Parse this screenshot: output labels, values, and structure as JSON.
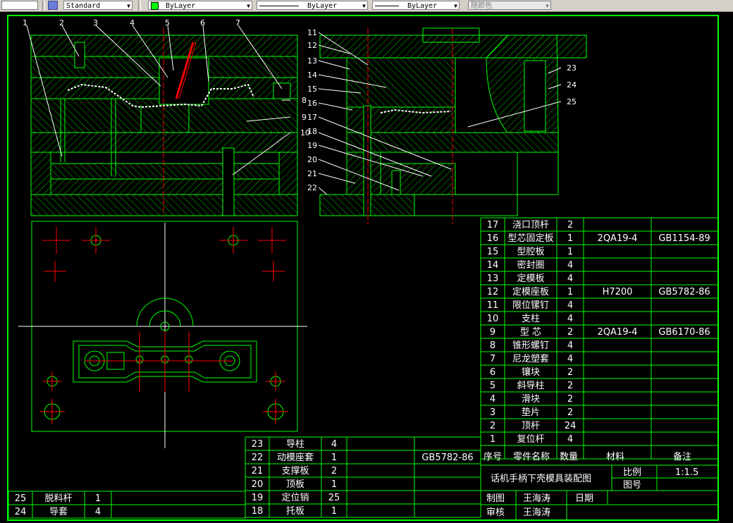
{
  "toolbar": {
    "textstyle": "Standard",
    "layer": "ByLayer",
    "linetype": "ByLayer",
    "lineweight": "ByLayer",
    "plotstyle": "随颜色"
  },
  "callouts": [
    "1",
    "2",
    "3",
    "4",
    "5",
    "6",
    "7",
    "8",
    "9",
    "10",
    "11",
    "12",
    "13",
    "14",
    "15",
    "16",
    "17",
    "18",
    "19",
    "20",
    "21",
    "22",
    "23",
    "24",
    "25"
  ],
  "parts": [
    {
      "no": "17",
      "name": "浇口顶杆",
      "qty": "2",
      "mat": "",
      "note": ""
    },
    {
      "no": "16",
      "name": "型芯固定板",
      "qty": "1",
      "mat": "2QA19-4",
      "note": "GB1154-89"
    },
    {
      "no": "15",
      "name": "型腔板",
      "qty": "1",
      "mat": "",
      "note": ""
    },
    {
      "no": "14",
      "name": "密封圈",
      "qty": "4",
      "mat": "",
      "note": ""
    },
    {
      "no": "13",
      "name": "定模板",
      "qty": "4",
      "mat": "",
      "note": ""
    },
    {
      "no": "12",
      "name": "定模座板",
      "qty": "1",
      "mat": "H7200",
      "note": "GB5782-86"
    },
    {
      "no": "11",
      "name": "限位镙钉",
      "qty": "4",
      "mat": "",
      "note": ""
    },
    {
      "no": "10",
      "name": "支柱",
      "qty": "4",
      "mat": "",
      "note": ""
    },
    {
      "no": "9",
      "name": "型  芯",
      "qty": "2",
      "mat": "2QA19-4",
      "note": "GB6170-86"
    },
    {
      "no": "8",
      "name": "锥形螺钉",
      "qty": "4",
      "mat": "",
      "note": ""
    },
    {
      "no": "7",
      "name": "尼龙塑套",
      "qty": "4",
      "mat": "",
      "note": ""
    },
    {
      "no": "6",
      "name": "镶块",
      "qty": "2",
      "mat": "",
      "note": ""
    },
    {
      "no": "5",
      "name": "斜导柱",
      "qty": "2",
      "mat": "",
      "note": ""
    },
    {
      "no": "4",
      "name": "滑块",
      "qty": "2",
      "mat": "",
      "note": ""
    },
    {
      "no": "3",
      "name": "垫片",
      "qty": "2",
      "mat": "",
      "note": ""
    },
    {
      "no": "2",
      "name": "顶杆",
      "qty": "24",
      "mat": "",
      "note": ""
    },
    {
      "no": "1",
      "name": "复位杆",
      "qty": "4",
      "mat": "",
      "note": ""
    }
  ],
  "parts_header": {
    "no": "序号",
    "name": "零件名称",
    "qty": "数量",
    "mat": "材料",
    "note": "备注"
  },
  "parts2": [
    {
      "no": "23",
      "name": "导柱",
      "qty": "4",
      "note": ""
    },
    {
      "no": "22",
      "name": "动模座套",
      "qty": "1",
      "note": "GB5782-86"
    },
    {
      "no": "21",
      "name": "支撑板",
      "qty": "2",
      "note": ""
    },
    {
      "no": "20",
      "name": "顶板",
      "qty": "1",
      "note": ""
    },
    {
      "no": "19",
      "name": "定位销",
      "qty": "25",
      "note": ""
    },
    {
      "no": "18",
      "name": "托板",
      "qty": "1",
      "note": ""
    }
  ],
  "parts3": [
    {
      "no": "25",
      "name": "脱料杆",
      "qty": "1"
    },
    {
      "no": "24",
      "name": "导套",
      "qty": "4"
    }
  ],
  "title_block": {
    "title": "话机手柄下壳模具装配图",
    "scale_label": "比例",
    "scale_value": "1:1.5",
    "drawing_no_label": "图号",
    "drawn_label": "制图",
    "drawn_by": "王海涛",
    "date_label": "日期",
    "checked_label": "审核",
    "checked_by": "王海涛"
  },
  "colors": {
    "line": "#00ff00",
    "text": "#ffffff",
    "red": "#ff0000",
    "hatch": "#00c000",
    "toolbar": "#d4d0c8"
  }
}
